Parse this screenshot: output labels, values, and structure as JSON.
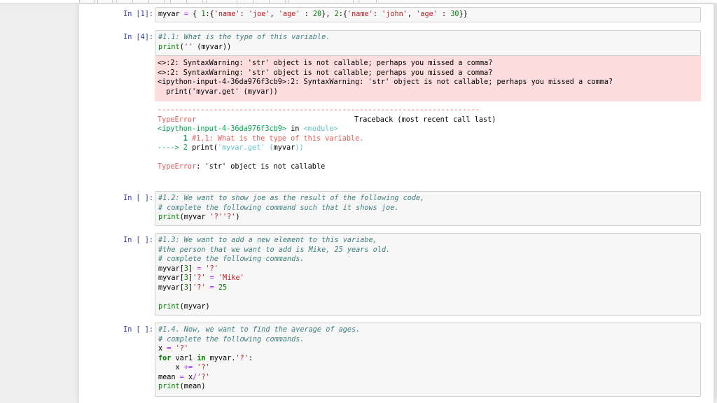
{
  "cells": [
    {
      "prompt": "In [1]:",
      "code": [
        [
          [
            "myvar ",
            ""
          ],
          [
            "=",
            "o"
          ],
          [
            " { ",
            ""
          ],
          [
            "1",
            "n"
          ],
          [
            ":{",
            ""
          ],
          [
            "'name'",
            "s"
          ],
          [
            ": ",
            ""
          ],
          [
            "'joe'",
            "s"
          ],
          [
            ", ",
            ""
          ],
          [
            "'age'",
            "s"
          ],
          [
            " : ",
            ""
          ],
          [
            "20",
            "n"
          ],
          [
            "}, ",
            ""
          ],
          [
            "2",
            "n"
          ],
          [
            ":{",
            ""
          ],
          [
            "'name'",
            "s"
          ],
          [
            ": ",
            ""
          ],
          [
            "'john'",
            "s"
          ],
          [
            ", ",
            ""
          ],
          [
            "'age'",
            "s"
          ],
          [
            " : ",
            ""
          ],
          [
            "30",
            "n"
          ],
          [
            "}}",
            ""
          ]
        ]
      ]
    },
    {
      "prompt": "In [4]:",
      "code": [
        [
          [
            "#1.1: What is the type of this variable.",
            "cm"
          ]
        ],
        [
          [
            "print",
            "b"
          ],
          [
            "(",
            ""
          ],
          [
            "''",
            "s"
          ],
          [
            " (myvar))",
            ""
          ]
        ]
      ],
      "stderr": [
        "<>:2: SyntaxWarning: 'str' object is not callable; perhaps you missed a comma?",
        "<>:2: SyntaxWarning: 'str' object is not callable; perhaps you missed a comma?",
        "<ipython-input-4-36da976f3cb9>:2: SyntaxWarning: 'str' object is not callable; perhaps you missed a comma?",
        "  print('myvar.get' (myvar))"
      ],
      "traceback": {
        "separator": "---------------------------------------------------------------------------",
        "error_name": "TypeError",
        "traceback_header": "Traceback (most recent call last)",
        "source_file": "<ipython-input-4-36da976f3cb9>",
        "in_word": " in ",
        "module": "<module>",
        "line1_num": "      1 ",
        "line1_text": "#1.1: What is the type of this variable.",
        "line2_arrow": "----> 2 ",
        "line2_pre": "print(",
        "line2_str": "'myvar.get'",
        "line2_post_open": " (",
        "line2_var": "myvar",
        "line2_close": "))",
        "final_error_name": "TypeError",
        "final_error_msg": ": 'str' object is not callable"
      }
    },
    {
      "prompt": "In [ ]:",
      "code": [
        [
          [
            "#1.2: We want to show joe as the result of the following code,",
            "cm"
          ]
        ],
        [
          [
            "# complete the following command such that it shows joe.",
            "cm"
          ]
        ],
        [
          [
            "print",
            "b"
          ],
          [
            "(myvar ",
            ""
          ],
          [
            "'?''?'",
            "s"
          ],
          [
            ")",
            ""
          ]
        ]
      ]
    },
    {
      "prompt": "In [ ]:",
      "code": [
        [
          [
            "#1.3: We want to add a new element to this variabe,",
            "cm"
          ]
        ],
        [
          [
            "#the person that we want to add is Mike, 25 years old.",
            "cm"
          ]
        ],
        [
          [
            "# complete the following commands.",
            "cm"
          ]
        ],
        [
          [
            "myvar[",
            ""
          ],
          [
            "3",
            "n"
          ],
          [
            "] ",
            ""
          ],
          [
            "=",
            "o"
          ],
          [
            " ",
            ""
          ],
          [
            "'?'",
            "s"
          ]
        ],
        [
          [
            "myvar[",
            ""
          ],
          [
            "3",
            "n"
          ],
          [
            "]",
            ""
          ],
          [
            "'?'",
            "s"
          ],
          [
            " ",
            ""
          ],
          [
            "=",
            "o"
          ],
          [
            " ",
            ""
          ],
          [
            "'Mike'",
            "s"
          ]
        ],
        [
          [
            "myvar[",
            ""
          ],
          [
            "3",
            "n"
          ],
          [
            "]",
            ""
          ],
          [
            "'?'",
            "s"
          ],
          [
            " ",
            ""
          ],
          [
            "=",
            "o"
          ],
          [
            " ",
            ""
          ],
          [
            "25",
            "n"
          ]
        ],
        [
          [
            "",
            ""
          ]
        ],
        [
          [
            "print",
            "b"
          ],
          [
            "(myvar)",
            ""
          ]
        ]
      ]
    },
    {
      "prompt": "In [ ]:",
      "code": [
        [
          [
            "#1.4. Now, we want to find the average of ages.",
            "cm"
          ]
        ],
        [
          [
            "# complete the following commands.",
            "cm"
          ]
        ],
        [
          [
            "x ",
            ""
          ],
          [
            "=",
            "o"
          ],
          [
            " ",
            ""
          ],
          [
            "'?'",
            "s"
          ]
        ],
        [
          [
            "for",
            "k"
          ],
          [
            " var1 ",
            ""
          ],
          [
            "in",
            "k"
          ],
          [
            " myvar.",
            ""
          ],
          [
            "'?'",
            "s"
          ],
          [
            ":",
            ""
          ]
        ],
        [
          [
            "    x ",
            ""
          ],
          [
            "+=",
            "o"
          ],
          [
            " ",
            ""
          ],
          [
            "'?'",
            "s"
          ]
        ],
        [
          [
            "mean ",
            ""
          ],
          [
            "=",
            "o"
          ],
          [
            " x",
            ""
          ],
          [
            "/",
            "o"
          ],
          [
            "'?'",
            "s"
          ]
        ],
        [
          [
            "print",
            "b"
          ],
          [
            "(mean)",
            ""
          ]
        ]
      ]
    }
  ]
}
